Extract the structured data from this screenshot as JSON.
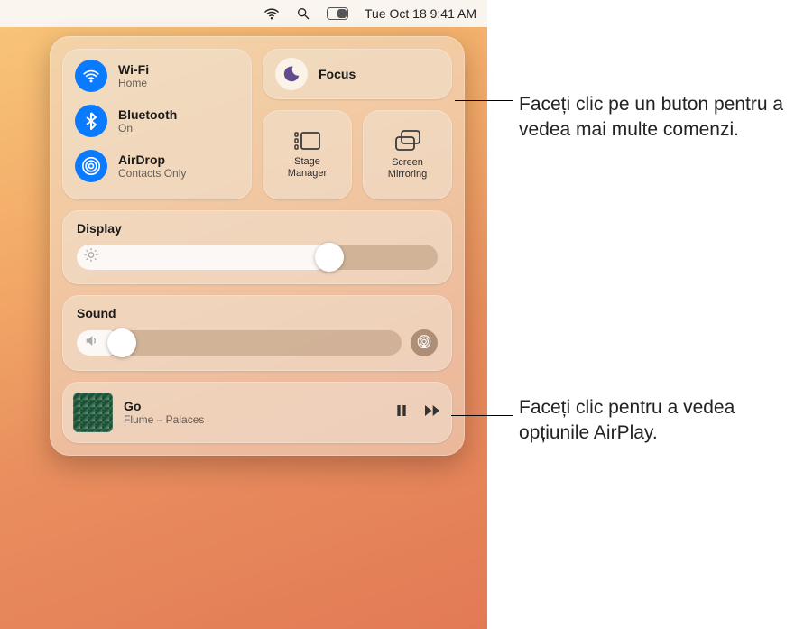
{
  "menubar": {
    "datetime": "Tue Oct 18  9:41 AM"
  },
  "connectivity": {
    "wifi": {
      "title": "Wi-Fi",
      "status": "Home"
    },
    "bluetooth": {
      "title": "Bluetooth",
      "status": "On"
    },
    "airdrop": {
      "title": "AirDrop",
      "status": "Contacts Only"
    }
  },
  "focus": {
    "label": "Focus"
  },
  "stage_manager": {
    "label": "Stage Manager"
  },
  "screen_mirroring": {
    "label": "Screen Mirroring"
  },
  "display": {
    "label": "Display",
    "value_pct": 70
  },
  "sound": {
    "label": "Sound",
    "value_pct": 12
  },
  "now_playing": {
    "title": "Go",
    "subtitle": "Flume – Palaces"
  },
  "callouts": {
    "focus": "Faceți clic pe un buton pentru a vedea mai multe comenzi.",
    "airplay": "Faceți clic pentru a vedea opțiunile AirPlay."
  }
}
